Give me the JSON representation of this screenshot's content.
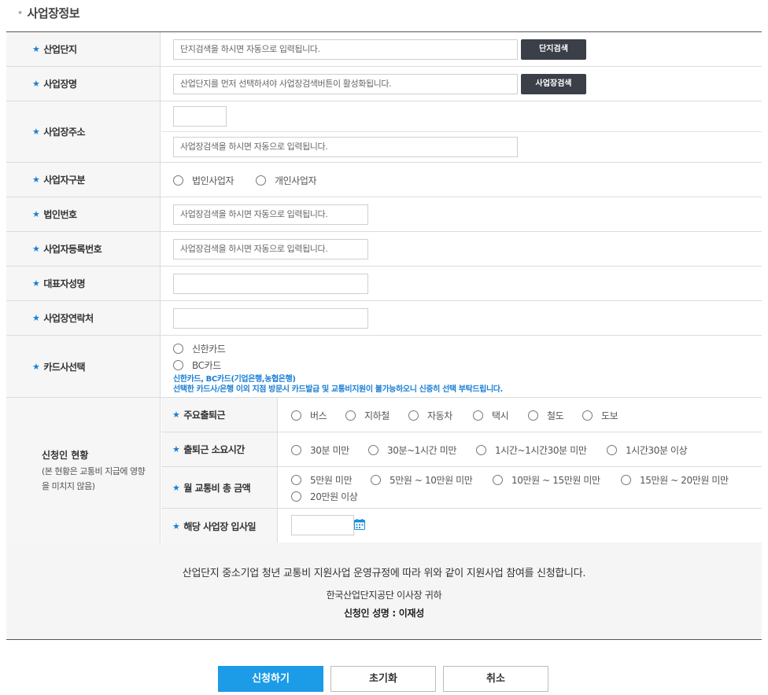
{
  "section_title": "사업장정보",
  "colors": {
    "accent": "#1a7fd4",
    "primary_button": "#1c9be6",
    "dark_button": "#3a3f48"
  },
  "fields": {
    "complex": {
      "label": "산업단지",
      "placeholder": "단지검색을 하시면 자동으로 입력됩니다.",
      "button": "단지검색"
    },
    "workplace_name": {
      "label": "사업장명",
      "placeholder": "산업단지를 먼저 선택하셔야 사업장검색버튼이 활성화됩니다.",
      "button": "사업장검색"
    },
    "address": {
      "label": "사업장주소",
      "zip": "",
      "placeholder": "사업장검색을 하시면 자동으로 입력됩니다."
    },
    "business_type": {
      "label": "사업자구분",
      "options": [
        "법인사업자",
        "개인사업자"
      ]
    },
    "corp_number": {
      "label": "법인번호",
      "placeholder": "사업장검색을 하시면 자동으로 입력됩니다."
    },
    "biz_reg_number": {
      "label": "사업자등록번호",
      "placeholder": "사업장검색을 하시면 자동으로 입력됩니다."
    },
    "ceo_name": {
      "label": "대표자성명",
      "value": ""
    },
    "contact": {
      "label": "사업장연락처",
      "value": ""
    },
    "card": {
      "label": "카드사선택",
      "options": [
        "신한카드",
        "BC카드"
      ],
      "note1": "신한카드,  BC카드(기업은행,농협은행)",
      "note2": "선택한 카드사/은행 이외 지점 방문시 카드발급 및 교통비지원이 불가능하오니 신중히 선택 부탁드립니다."
    }
  },
  "applicant": {
    "title": "신청인 현황",
    "subtitle": "(본 현황은 교통비 지급에 영향을 미치지 않음)",
    "commute_mode": {
      "label": "주요출퇴근",
      "options": [
        "버스",
        "지하철",
        "자동차",
        "택시",
        "철도",
        "도보"
      ]
    },
    "commute_time": {
      "label": "출퇴근 소요시간",
      "options": [
        "30분 미만",
        "30분~1시간 미만",
        "1시간~1시간30분 미만",
        "1시간30분 이상"
      ]
    },
    "monthly_cost": {
      "label": "월 교통비 총 금액",
      "options": [
        "5만원 미만",
        "5만원 ~ 10만원 미만",
        "10만원 ~ 15만원 미만",
        "15만원 ~ 20만원 미만",
        "20만원 이상"
      ]
    },
    "join_date": {
      "label": "해당 사업장 입사일",
      "value": "",
      "icon": "calendar-icon"
    }
  },
  "agreement": {
    "line1": "산업단지 중소기업 청년 교통비 지원사업 운영규정에 따라 위와 같이 지원사업 참여를 신청합니다.",
    "line2": "한국산업단지공단 이사장 귀하",
    "line3": "신청인 성명 : 이재성"
  },
  "buttons": {
    "submit": "신청하기",
    "reset": "초기화",
    "cancel": "취소"
  }
}
